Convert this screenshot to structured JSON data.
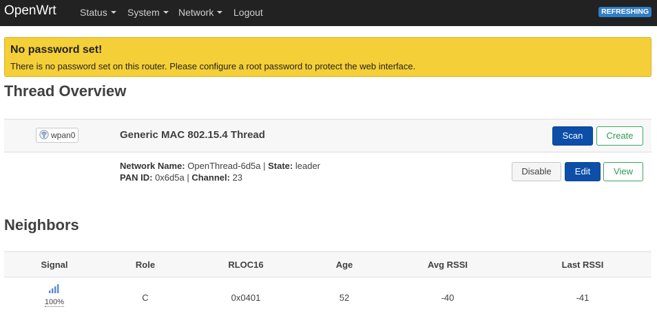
{
  "navbar": {
    "brand": "OpenWrt",
    "items": [
      {
        "label": "Status",
        "has_menu": true
      },
      {
        "label": "System",
        "has_menu": true
      },
      {
        "label": "Network",
        "has_menu": true
      },
      {
        "label": "Logout",
        "has_menu": false
      }
    ],
    "refresh_badge": "REFRESHING"
  },
  "alert": {
    "title": "No password set!",
    "text": "There is no password set on this router. Please configure a root password to protect the web interface."
  },
  "thread_overview": {
    "heading": "Thread Overview",
    "interface": {
      "badge_label": "wpan0",
      "badge_icon": "wireless-icon",
      "name": "Generic MAC 802.15.4 Thread",
      "scan_label": "Scan",
      "create_label": "Create",
      "network_name_label": "Network Name:",
      "network_name": "OpenThread-6d5a",
      "state_label": "State:",
      "state": "leader",
      "pan_id_label": "PAN ID:",
      "pan_id": "0x6d5a",
      "channel_label": "Channel:",
      "channel": "23",
      "disable_label": "Disable",
      "edit_label": "Edit",
      "view_label": "View"
    }
  },
  "neighbors": {
    "heading": "Neighbors",
    "columns": [
      "Signal",
      "Role",
      "RLOC16",
      "Age",
      "Avg RSSI",
      "Last RSSI"
    ],
    "rows": [
      {
        "signal": "100%",
        "signal_icon": "signal-bars-icon",
        "role": "C",
        "rloc16": "0x0401",
        "age": "52",
        "avg_rssi": "-40",
        "last_rssi": "-41"
      }
    ]
  },
  "colors": {
    "navbar_bg": "#222222",
    "alert_bg": "#f4cf37",
    "primary": "#0d4fa8",
    "success": "#36a459",
    "refresh_badge": "#2f7ec7"
  }
}
